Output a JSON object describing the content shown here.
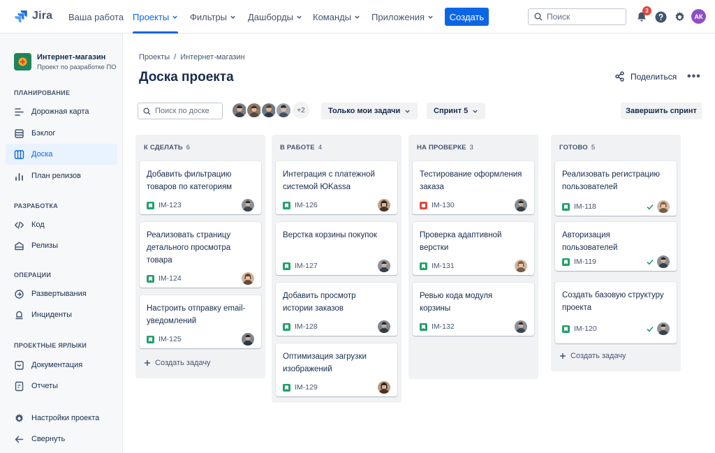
{
  "app": {
    "name": "Jira"
  },
  "nav": {
    "items": [
      "Ваша работа",
      "Проекты",
      "Фильтры",
      "Дашборды",
      "Команды",
      "Приложения"
    ],
    "create_label": "Создать",
    "search_placeholder": "Поиск",
    "notifications_count": "3",
    "user_initials": "АК"
  },
  "sidebar": {
    "project_name": "Интернет-магазин",
    "project_desc": "Проект по разработке ПО",
    "sections": [
      "ПЛАНИРОВАНИЕ",
      "РАЗРАБОТКА",
      "ОПЕРАЦИИ",
      "ПРОЕКТНЫЕ ЯРЛЫКИ"
    ],
    "items": [
      "Дорожная карта",
      "Бэклог",
      "Доска",
      "План релизов",
      "Код",
      "Релизы",
      "Развертывания",
      "Инциденты",
      "Документация",
      "Отчеты",
      "Настройки проекта",
      "Свернуть"
    ]
  },
  "main": {
    "breadcrumb": [
      "Проекты",
      "/",
      "Интернет-магазин"
    ],
    "title": "Доска проекта",
    "share_label": "Поделиться",
    "board_search_placeholder": "Поиск по доске",
    "avatars_more": "+2",
    "filter_mine": "Только мои задачи",
    "sprint": "Спринт 5",
    "complete_sprint": "Завершить спринт"
  },
  "colors": {
    "accent": "#0c66e4",
    "story": "#22a06b",
    "bug": "#e2483d",
    "done": "#22a06b"
  },
  "columns": [
    {
      "name": "К СДЕЛАТЬ",
      "count": "6",
      "cards": [
        {
          "title": "Добавить фильтрацию товаров по категориям",
          "key": "IM-123",
          "type": "story"
        },
        {
          "title": "Реализовать страницу детального просмотра товара",
          "key": "IM-124",
          "type": "story"
        },
        {
          "title": "Настроить отправку email-уведомлений",
          "key": "IM-125",
          "type": "story"
        }
      ],
      "add_label": "Создать задачу"
    },
    {
      "name": "В РАБОТЕ",
      "count": "4",
      "cards": [
        {
          "title": "Интеграция с платежной системой ЮKassa",
          "key": "IM-126",
          "type": "story"
        },
        {
          "title": "Верстка корзины покупок",
          "key": "IM-127",
          "type": "story"
        },
        {
          "title": "Добавить просмотр истории заказов",
          "key": "IM-128",
          "type": "story"
        },
        {
          "title": "Оптимизация загрузки изображений",
          "key": "IM-129",
          "type": "story"
        }
      ]
    },
    {
      "name": "НА ПРОВЕРКЕ",
      "count": "3",
      "cards": [
        {
          "title": "Тестирование оформления заказа",
          "key": "IM-130",
          "type": "bug"
        },
        {
          "title": "Проверка адаптивной верстки",
          "key": "IM-131",
          "type": "story"
        },
        {
          "title": "Ревью кода модуля корзины",
          "key": "IM-132",
          "type": "story"
        }
      ]
    },
    {
      "name": "ГОТОВО",
      "count": "5",
      "cards": [
        {
          "title": "Реализовать регистрацию пользователей",
          "key": "IM-118",
          "type": "story",
          "done": true
        },
        {
          "title": "Авторизация пользователей",
          "key": "IM-119",
          "type": "story",
          "done": true
        },
        {
          "title": "Создать базовую структуру проекта",
          "key": "IM-120",
          "type": "story",
          "done": true
        }
      ],
      "add_label": "Создать задачу"
    }
  ]
}
